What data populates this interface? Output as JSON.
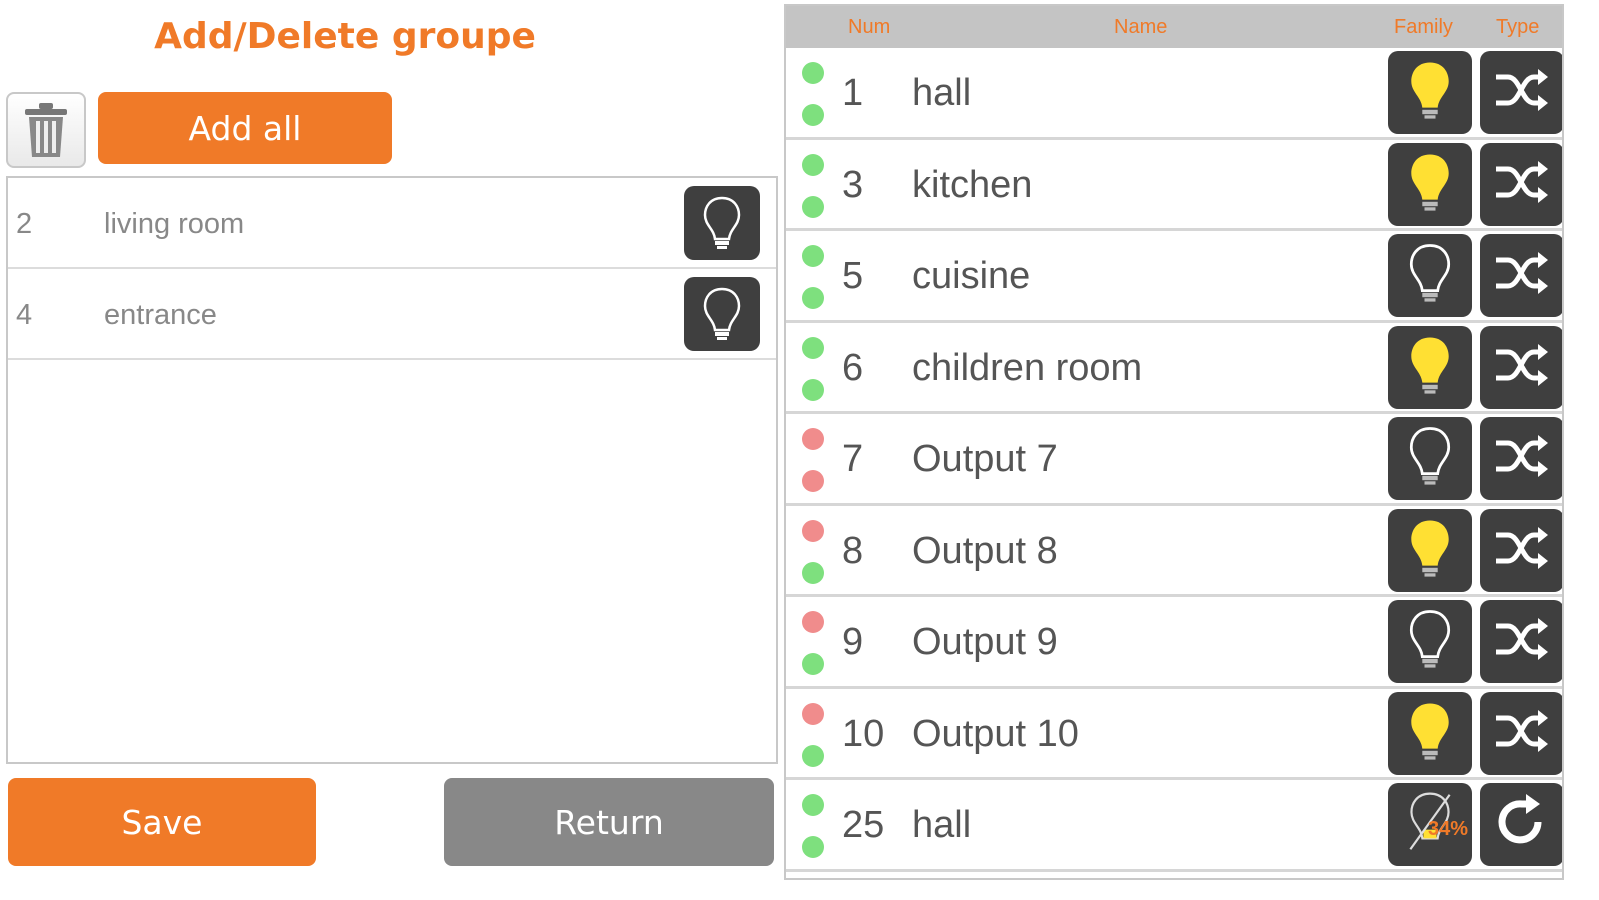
{
  "title": "Add/Delete groupe",
  "buttons": {
    "add_all": "Add all",
    "save": "Save",
    "return": "Return"
  },
  "colors": {
    "accent": "#f07a28",
    "dark_button": "#3f3f3f",
    "status_green": "#7ee07e",
    "status_red": "#f08c8c",
    "bulb_on": "#ffe033"
  },
  "group_items": [
    {
      "num": "2",
      "name": "living room",
      "icon": "bulb-off-icon"
    },
    {
      "num": "4",
      "name": "entrance",
      "icon": "bulb-off-icon"
    }
  ],
  "outputs": {
    "headers": {
      "num": "Num",
      "name": "Name",
      "family": "Family",
      "type": "Type"
    },
    "rows": [
      {
        "num": "1",
        "name": "hall",
        "dot_top": "green",
        "dot_bottom": "green",
        "bulb": "on",
        "type_icon": "shuffle-icon"
      },
      {
        "num": "3",
        "name": "kitchen",
        "dot_top": "green",
        "dot_bottom": "green",
        "bulb": "on",
        "type_icon": "shuffle-icon"
      },
      {
        "num": "5",
        "name": "cuisine",
        "dot_top": "green",
        "dot_bottom": "green",
        "bulb": "off",
        "type_icon": "shuffle-icon"
      },
      {
        "num": "6",
        "name": "children room",
        "dot_top": "green",
        "dot_bottom": "green",
        "bulb": "on",
        "type_icon": "shuffle-icon"
      },
      {
        "num": "7",
        "name": "Output 7",
        "dot_top": "red",
        "dot_bottom": "red",
        "bulb": "off",
        "type_icon": "shuffle-icon"
      },
      {
        "num": "8",
        "name": "Output 8",
        "dot_top": "red",
        "dot_bottom": "green",
        "bulb": "on",
        "type_icon": "shuffle-icon"
      },
      {
        "num": "9",
        "name": "Output 9",
        "dot_top": "red",
        "dot_bottom": "green",
        "bulb": "off",
        "type_icon": "shuffle-icon"
      },
      {
        "num": "10",
        "name": "Output 10",
        "dot_top": "red",
        "dot_bottom": "green",
        "bulb": "on",
        "type_icon": "shuffle-icon"
      },
      {
        "num": "25",
        "name": "hall",
        "dot_top": "green",
        "dot_bottom": "green",
        "bulb": "dimmer",
        "dimmer_label": "34%",
        "type_icon": "refresh-icon"
      }
    ]
  }
}
